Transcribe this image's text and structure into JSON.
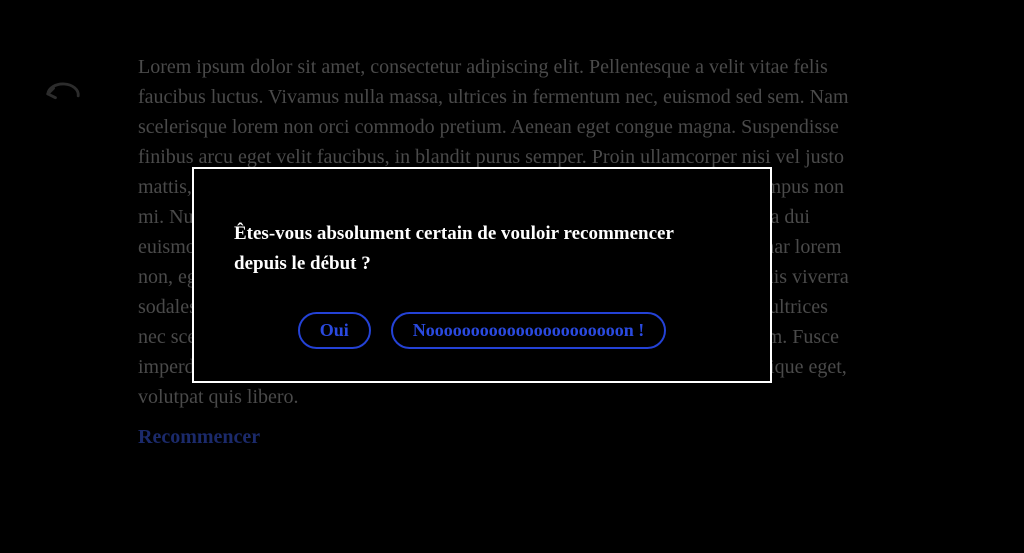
{
  "content": {
    "paragraph": "Lorem ipsum dolor sit amet, consectetur adipiscing elit. Pellentesque a velit vitae felis faucibus luctus. Vivamus nulla massa, ultrices in fermentum nec, euismod sed sem. Nam scelerisque lorem non orci commodo pretium. Aenean eget congue magna. Suspendisse finibus arcu eget velit faucibus, in blandit purus semper. Proin ullamcorper nisi vel justo mattis, id bibendum ligula. Sed magna orci, ullamcorper a tristique sit amet, tempus non mi. Nulla porttitor cursus tortor, eget placerat sem laoreet sit amet. Vestibulum a dui euismod, sagittis est et, consequat ipsum. Suspendisse ex purus, efficitur pulvinar lorem non, egestas luctus nisi. Sed sit amet Afermentum sem. Donec semper, lacus quis viverra sodales, lacus tincidunt et dui. At aliquam tortor lectus quis ex. In libero nulla, ultrices nec scelerisque malesuada ultrices ultricies. Vivamus laoreet facilisis fermentum. Fusce imperdiet viverra dictum. Mauris odio ipsum, condimentum condimentum tristique eget, volutpat quis libero.",
    "restart_link": "Recommencer"
  },
  "modal": {
    "question": "Êtes-vous absolument certain de vouloir recommencer depuis le début ?",
    "yes_label": "Oui",
    "no_label": "Noooooooooooooooooooooon !"
  }
}
